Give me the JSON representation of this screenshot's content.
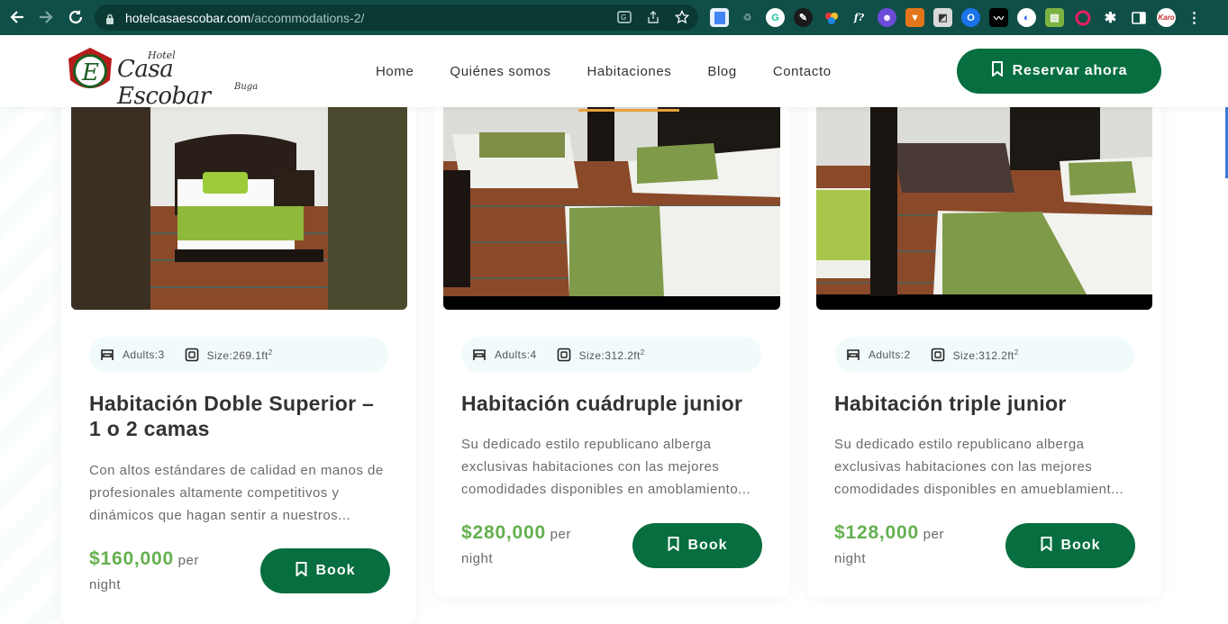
{
  "browser": {
    "url_host": "hotelcasaescobar.com",
    "url_path": "/accommodations-2/",
    "profile_label": "Karo"
  },
  "header": {
    "logo_text_hotel": "Hotel",
    "logo_text_name": "Casa Escobar",
    "logo_text_city": "Buga",
    "nav": [
      "Home",
      "Quiénes somos",
      "Habitaciones",
      "Blog",
      "Contacto"
    ],
    "active_nav": "Habitaciones",
    "reserve_label": "Reservar ahora"
  },
  "rooms": [
    {
      "adults": "Adults:3",
      "size": "Size:269.1ft",
      "size_sup": "2",
      "title_line1": "Habitación Doble Superior –",
      "title_line2": "1 o 2 camas",
      "desc_lines": [
        "Con altos estándares de calidad en manos de",
        "profesionales altamente competitivos y",
        "dinámicos que hagan sentir a nuestros..."
      ],
      "price": "$160,000",
      "per": "per",
      "night": "night",
      "book_label": "Book"
    },
    {
      "adults": "Adults:4",
      "size": "Size:312.2ft",
      "size_sup": "2",
      "title_line1": "Habitación cuádruple junior",
      "title_line2": "",
      "desc_lines": [
        "Su dedicado estilo republicano alberga",
        "exclusivas habitaciones con las mejores",
        "comodidades disponibles en amoblamiento..."
      ],
      "price": "$280,000",
      "per": "per",
      "night": "night",
      "book_label": "Book"
    },
    {
      "adults": "Adults:2",
      "size": "Size:312.2ft",
      "size_sup": "2",
      "title_line1": "Habitación triple junior",
      "title_line2": "",
      "desc_lines": [
        "Su dedicado estilo republicano alberga",
        "exclusivas habitaciones con las mejores",
        "comodidades disponibles en amueblamient..."
      ],
      "price": "$128,000",
      "per": "per",
      "night": "night",
      "book_label": "Book"
    }
  ],
  "colors": {
    "brand_green": "#066e3f",
    "price_green": "#64b04f",
    "nav_active": "#e6a13b",
    "chrome_bg": "#0f4f48"
  },
  "icons": {
    "bed": "bed-icon",
    "size": "size-icon",
    "bookmark": "bookmark-icon"
  }
}
